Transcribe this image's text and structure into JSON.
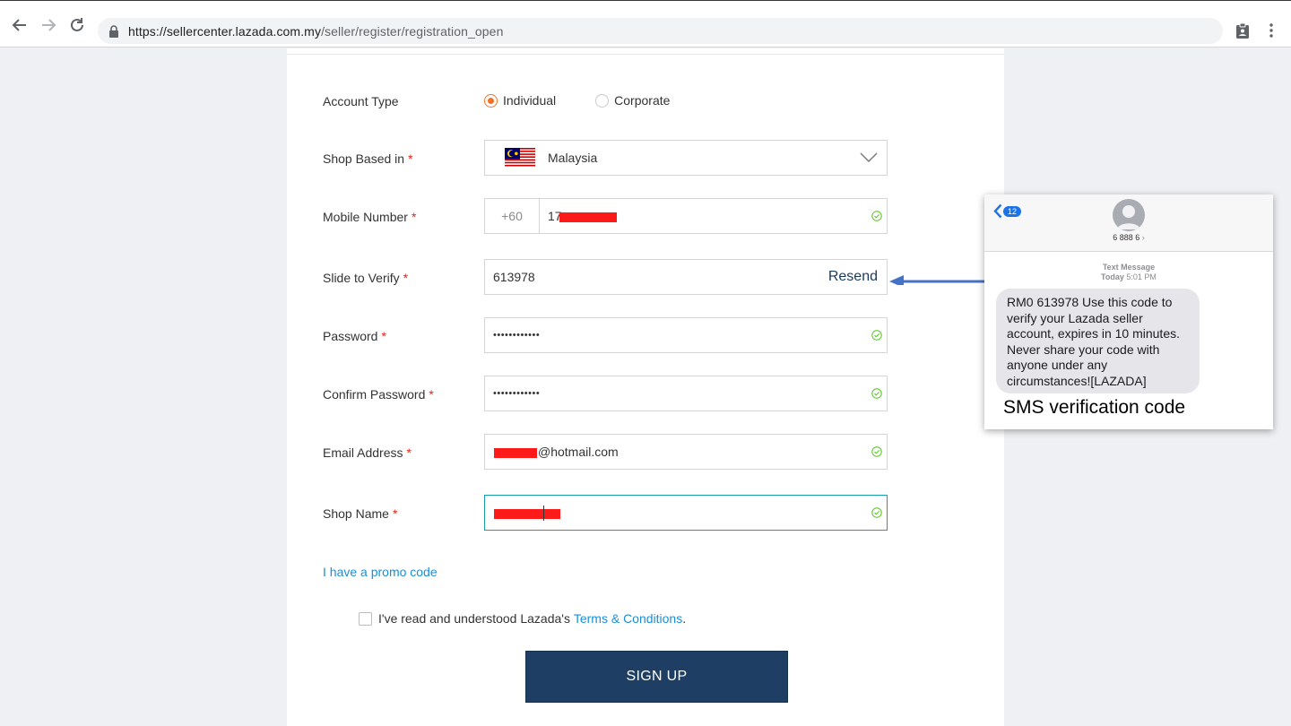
{
  "browser": {
    "url_host": "https://sellercenter.lazada.com.my",
    "url_path": "/seller/register/registration_open"
  },
  "form": {
    "account_type": {
      "label": "Account Type",
      "options": [
        "Individual",
        "Corporate"
      ],
      "selected": "Individual"
    },
    "shop_based_in": {
      "label": "Shop Based in",
      "value": "Malaysia"
    },
    "mobile": {
      "label": "Mobile Number",
      "prefix": "+60",
      "value": "17"
    },
    "verify": {
      "label": "Slide to Verify",
      "value": "613978",
      "resend": "Resend"
    },
    "password": {
      "label": "Password",
      "value": "••••••••••••"
    },
    "confirm_password": {
      "label": "Confirm Password",
      "value": "••••••••••••"
    },
    "email": {
      "label": "Email Address",
      "value": "@hotmail.com"
    },
    "shop_name": {
      "label": "Shop Name",
      "value": ""
    },
    "required_mark": "*",
    "promo": "I have a promo code",
    "terms_prefix": "I've read and understood Lazada's",
    "terms_link": "Terms & Conditions",
    "terms_suffix": ".",
    "signup": "SIGN UP"
  },
  "sms": {
    "back_count": "12",
    "contact": "6 888 6",
    "meta_type": "Text Message",
    "meta_day": "Today",
    "meta_time": "5:01 PM",
    "message": "RM0 613978 Use this code to verify your Lazada seller account, expires in 10 minutes. Never share your code with anyone under any circumstances![LAZADA]",
    "caption": "SMS verification code"
  },
  "colors": {
    "accent_orange": "#f57224",
    "signup_bg": "#1e3f63",
    "link": "#1a8fd6",
    "required": "#e62117",
    "success": "#52c41a",
    "arrow": "#4472c4"
  }
}
